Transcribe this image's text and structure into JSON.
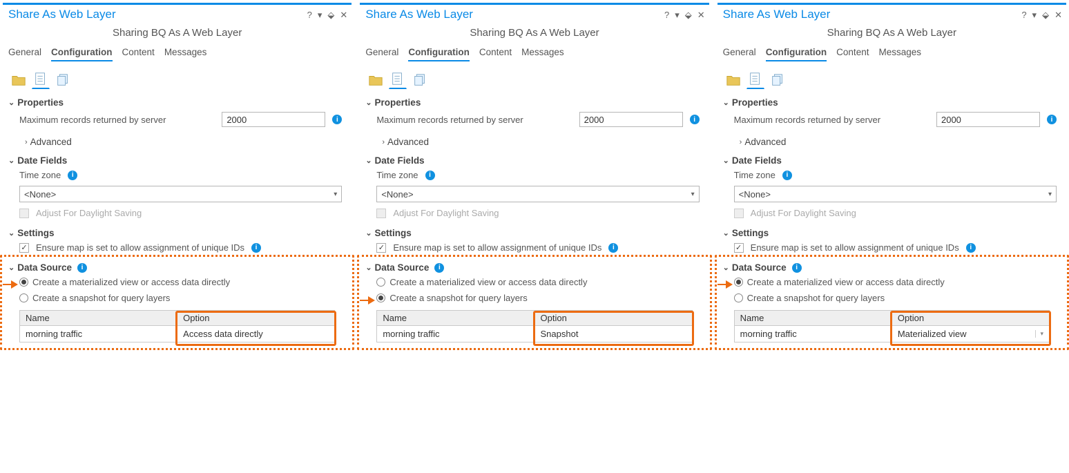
{
  "panes": [
    {
      "title": "Share As Web Layer",
      "subtitle": "Sharing BQ As A Web Layer",
      "tabs": [
        "General",
        "Configuration",
        "Content",
        "Messages"
      ],
      "active_tab": "Configuration",
      "properties": {
        "header": "Properties",
        "max_records_label": "Maximum records returned by server",
        "max_records_value": "2000",
        "advanced_label": "Advanced"
      },
      "date_fields": {
        "header": "Date Fields",
        "timezone_label": "Time zone",
        "timezone_value": "<None>",
        "daylight_label": "Adjust For Daylight Saving",
        "daylight_checked": false,
        "daylight_enabled": false
      },
      "settings": {
        "header": "Settings",
        "ensure_ids_label": "Ensure map is set to allow assignment of unique IDs",
        "ensure_ids_checked": true
      },
      "data_source": {
        "header": "Data Source",
        "radio1_label": "Create a materialized view or access data directly",
        "radio2_label": "Create a snapshot for query layers",
        "radio_selected": 1,
        "table_headers": [
          "Name",
          "Option"
        ],
        "row_name": "morning traffic",
        "row_option": "Access data directly",
        "option_is_dropdown": false
      }
    },
    {
      "title": "Share As Web Layer",
      "subtitle": "Sharing BQ As A Web Layer",
      "tabs": [
        "General",
        "Configuration",
        "Content",
        "Messages"
      ],
      "active_tab": "Configuration",
      "properties": {
        "header": "Properties",
        "max_records_label": "Maximum records returned by server",
        "max_records_value": "2000",
        "advanced_label": "Advanced"
      },
      "date_fields": {
        "header": "Date Fields",
        "timezone_label": "Time zone",
        "timezone_value": "<None>",
        "daylight_label": "Adjust For Daylight Saving",
        "daylight_checked": false,
        "daylight_enabled": false
      },
      "settings": {
        "header": "Settings",
        "ensure_ids_label": "Ensure map is set to allow assignment of unique IDs",
        "ensure_ids_checked": true
      },
      "data_source": {
        "header": "Data Source",
        "radio1_label": "Create a materialized view or access data directly",
        "radio2_label": "Create a snapshot for query layers",
        "radio_selected": 2,
        "table_headers": [
          "Name",
          "Option"
        ],
        "row_name": "morning traffic",
        "row_option": "Snapshot",
        "option_is_dropdown": false
      }
    },
    {
      "title": "Share As Web Layer",
      "subtitle": "Sharing BQ As A Web Layer",
      "tabs": [
        "General",
        "Configuration",
        "Content",
        "Messages"
      ],
      "active_tab": "Configuration",
      "properties": {
        "header": "Properties",
        "max_records_label": "Maximum records returned by server",
        "max_records_value": "2000",
        "advanced_label": "Advanced"
      },
      "date_fields": {
        "header": "Date Fields",
        "timezone_label": "Time zone",
        "timezone_value": "<None>",
        "daylight_label": "Adjust For Daylight Saving",
        "daylight_checked": false,
        "daylight_enabled": false
      },
      "settings": {
        "header": "Settings",
        "ensure_ids_label": "Ensure map is set to allow assignment of unique IDs",
        "ensure_ids_checked": true
      },
      "data_source": {
        "header": "Data Source",
        "radio1_label": "Create a materialized view or access data directly",
        "radio2_label": "Create a snapshot for query layers",
        "radio_selected": 1,
        "table_headers": [
          "Name",
          "Option"
        ],
        "row_name": "morning traffic",
        "row_option": "Materialized view",
        "option_is_dropdown": true
      }
    }
  ],
  "icons": {
    "help": "?",
    "dropdown": "▾",
    "pin": "⇩",
    "close": "✕"
  }
}
